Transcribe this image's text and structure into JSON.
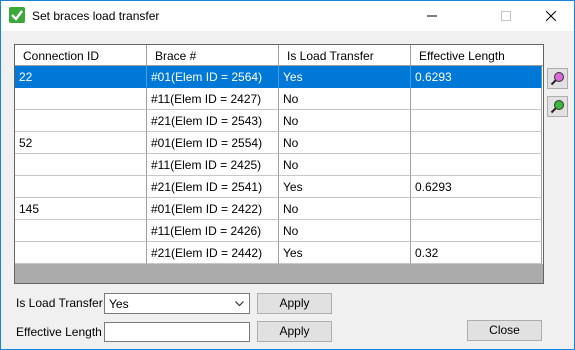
{
  "window": {
    "title": "Set braces load transfer"
  },
  "grid": {
    "columns": [
      "Connection ID",
      "Brace #",
      "Is Load Transfer",
      "Effective Length"
    ],
    "rows": [
      [
        "22",
        "#01(Elem ID = 2564)",
        "Yes",
        "0.6293"
      ],
      [
        "",
        "#11(Elem ID = 2427)",
        "No",
        ""
      ],
      [
        "",
        "#21(Elem ID = 2543)",
        "No",
        ""
      ],
      [
        "52",
        "#01(Elem ID = 2554)",
        "No",
        ""
      ],
      [
        "",
        "#11(Elem ID = 2425)",
        "No",
        ""
      ],
      [
        "",
        "#21(Elem ID = 2541)",
        "Yes",
        "0.6293"
      ],
      [
        "145",
        "#01(Elem ID = 2422)",
        "No",
        ""
      ],
      [
        "",
        "#11(Elem ID = 2426)",
        "No",
        ""
      ],
      [
        "",
        "#21(Elem ID = 2442)",
        "Yes",
        "0.32"
      ]
    ],
    "selected_row": 0
  },
  "side_buttons": {
    "top_icon": "zoom-magenta-icon",
    "bottom_icon": "zoom-green-icon"
  },
  "form": {
    "load_transfer_label": "Is Load Transfer",
    "load_transfer_value": "Yes",
    "effective_length_label": "Effective Length",
    "effective_length_value": "",
    "apply_label": "Apply",
    "close_label": "Close"
  },
  "colors": {
    "selection": "#0078d7",
    "border_accent": "#1883d7"
  }
}
